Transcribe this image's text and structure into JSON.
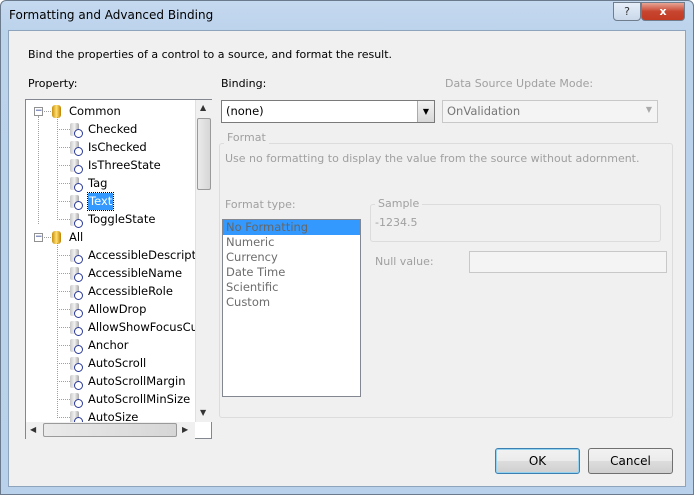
{
  "window": {
    "title": "Formatting and Advanced Binding",
    "help": "?",
    "close": "x"
  },
  "description": "Bind the properties of a control to a source, and format the result.",
  "property_label": "Property:",
  "binding_label": "Binding:",
  "update_mode_label": "Data Source Update Mode:",
  "binding_value": "(none)",
  "update_mode_value": "OnValidation",
  "tree": {
    "groups": [
      {
        "label": "Common",
        "items": [
          "Checked",
          "IsChecked",
          "IsThreeState",
          "Tag",
          "Text",
          "ToggleState"
        ]
      },
      {
        "label": "All",
        "items": [
          "AccessibleDescriptio",
          "AccessibleName",
          "AccessibleRole",
          "AllowDrop",
          "AllowShowFocusCu",
          "Anchor",
          "AutoScroll",
          "AutoScrollMargin",
          "AutoScrollMinSize",
          "AutoSize"
        ]
      }
    ],
    "selected": "Text"
  },
  "format": {
    "group_title": "Format",
    "hint": "Use no formatting to display the value from the source without adornment.",
    "type_label": "Format type:",
    "types": [
      "No Formatting",
      "Numeric",
      "Currency",
      "Date Time",
      "Scientific",
      "Custom"
    ],
    "selected_type": "No Formatting",
    "sample_label": "Sample",
    "sample_value": "-1234.5",
    "null_label": "Null value:",
    "null_value": ""
  },
  "buttons": {
    "ok": "OK",
    "cancel": "Cancel"
  }
}
